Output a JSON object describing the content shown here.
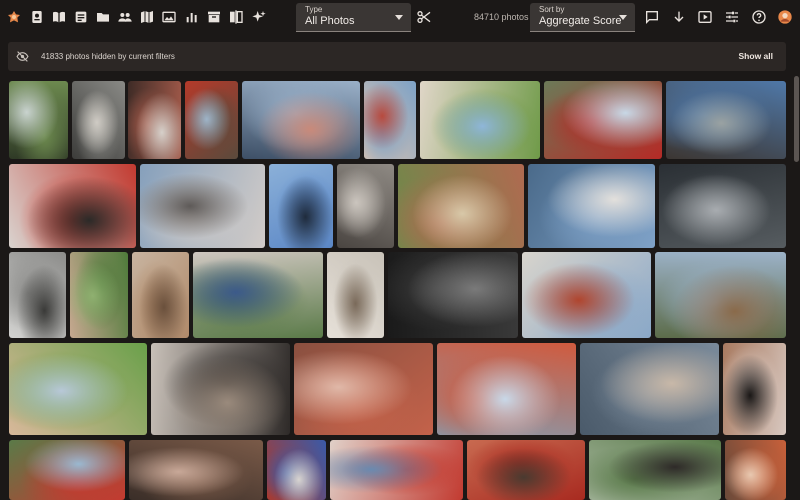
{
  "toolbar": {
    "left_icons": [
      "logo-icon",
      "person-badge-icon",
      "book-open-icon",
      "notes-icon",
      "folder-icon",
      "people-icon",
      "map-icon",
      "photo-library-icon",
      "bar-chart-icon",
      "archive-box-icon",
      "compare-icon",
      "sparkle-icon"
    ],
    "type_dropdown": {
      "label": "Type",
      "value": "All Photos"
    },
    "scissors_icon": "scissors-icon",
    "photo_count": "84710 photos",
    "sort_dropdown": {
      "label": "Sort by",
      "value": "Aggregate Score"
    },
    "right_icons": [
      "comment-icon",
      "sort-direction-icon",
      "slideshow-icon",
      "tune-icon",
      "help-icon",
      "avatar-icon"
    ]
  },
  "banner": {
    "icon": "eye-off-icon",
    "text": "41833 photos hidden by current filters",
    "action_label": "Show all"
  },
  "colors": {
    "background": "#1b1817",
    "banner": "#2c2725",
    "accent": "#e8884a"
  },
  "photos": [
    {
      "name": "photo-garden-path",
      "c": [
        "#6d8a4f",
        "#c9d3cf",
        "#2f3a26"
      ]
    },
    {
      "name": "photo-street-walkers",
      "c": [
        "#8a8a86",
        "#cfcbc4",
        "#3c3c3a"
      ]
    },
    {
      "name": "photo-child-red-clothes",
      "c": [
        "#a35a4a",
        "#d6d0ca",
        "#3e2b26"
      ]
    },
    {
      "name": "photo-child-tree-bench",
      "c": [
        "#5a4a3c",
        "#9eb4c8",
        "#b43a2a"
      ]
    },
    {
      "name": "photo-kids-hugging",
      "c": [
        "#9ab0c8",
        "#c98a7a",
        "#3d4f66"
      ]
    },
    {
      "name": "photo-woman-red-shirt",
      "c": [
        "#7ea2c6",
        "#b84a3e",
        "#d9c2b0"
      ]
    },
    {
      "name": "photo-child-pool",
      "c": [
        "#6f9a48",
        "#8fb6d9",
        "#e0d6c8"
      ]
    },
    {
      "name": "photo-red-flowers",
      "c": [
        "#b52a26",
        "#c8d8e6",
        "#6c7a58"
      ]
    },
    {
      "name": "photo-blue-doorway",
      "c": [
        "#4f78a8",
        "#9aa2a2",
        "#3c3632"
      ]
    },
    {
      "name": "photo-red-mask",
      "c": [
        "#c23a30",
        "#2b2a28",
        "#d9d3cf"
      ]
    },
    {
      "name": "photo-woman-headscarf",
      "c": [
        "#d2ccc8",
        "#5e5a58",
        "#86a0bc"
      ]
    },
    {
      "name": "photo-bicycle-sky",
      "c": [
        "#5b87c6",
        "#1f2b3c",
        "#8bb0d8"
      ]
    },
    {
      "name": "photo-child-window",
      "c": [
        "#8f8a84",
        "#cbc5be",
        "#4a4541"
      ]
    },
    {
      "name": "photo-girl-field",
      "c": [
        "#b06a50",
        "#d8c8a8",
        "#6c8a4a"
      ]
    },
    {
      "name": "photo-old-man-blue",
      "c": [
        "#7fa2c8",
        "#e3e0dc",
        "#4a6a8a"
      ]
    },
    {
      "name": "photo-misty-water",
      "c": [
        "#565c60",
        "#a8acb0",
        "#2a2f34"
      ]
    },
    {
      "name": "photo-street-scene",
      "c": [
        "#8c8c8a",
        "#3a3a38",
        "#d2d2d0"
      ]
    },
    {
      "name": "photo-tree-child",
      "c": [
        "#4e7a3a",
        "#8fb070",
        "#c6a890"
      ]
    },
    {
      "name": "photo-family-group",
      "c": [
        "#b08a6a",
        "#6a503c",
        "#c8b4a0"
      ]
    },
    {
      "name": "photo-family-outdoors",
      "c": [
        "#5a7a48",
        "#3c5a8a",
        "#cfc7c0"
      ]
    },
    {
      "name": "photo-child-white-hat",
      "c": [
        "#c8c2b8",
        "#7a6a5a",
        "#e6e0d8"
      ]
    },
    {
      "name": "photo-crowd-bw",
      "c": [
        "#3a3a3a",
        "#7a7a7a",
        "#1a1a1a"
      ]
    },
    {
      "name": "photo-umbrella-beach",
      "c": [
        "#8aa8c8",
        "#b0452e",
        "#d8d4cc"
      ]
    },
    {
      "name": "photo-people-hill",
      "c": [
        "#9cb2c8",
        "#8a6a4a",
        "#5c6c4a"
      ]
    },
    {
      "name": "photo-boy-green",
      "c": [
        "#6aa04a",
        "#b8c8d8",
        "#d8b89a"
      ]
    },
    {
      "name": "photo-child-bw-hands",
      "c": [
        "#2e2a28",
        "#9a8a7c",
        "#c8c0b8"
      ]
    },
    {
      "name": "photo-face-painting",
      "c": [
        "#c4624a",
        "#e0b8a8",
        "#8a5040"
      ]
    },
    {
      "name": "photo-child-cap-red",
      "c": [
        "#d05a3e",
        "#c8d8e8",
        "#8a98a8"
      ]
    },
    {
      "name": "photo-city-square",
      "c": [
        "#7a8a9a",
        "#c8b8a8",
        "#4a5a6a"
      ]
    },
    {
      "name": "photo-girl-black-top",
      "c": [
        "#d8c8c0",
        "#1a1716",
        "#a87a60"
      ]
    },
    {
      "name": "photo-red-car",
      "c": [
        "#c43a30",
        "#9ab8d0",
        "#5a7a48"
      ]
    },
    {
      "name": "photo-group-sitting",
      "c": [
        "#7a5a48",
        "#c8a898",
        "#3a2e28"
      ]
    },
    {
      "name": "photo-blue-character",
      "c": [
        "#3a5aa8",
        "#d8d4d0",
        "#a83a30"
      ]
    },
    {
      "name": "photo-red-crowd",
      "c": [
        "#c23a30",
        "#6a8ab0",
        "#e0d0c8"
      ]
    },
    {
      "name": "photo-festival-red",
      "c": [
        "#a82a20",
        "#4a3a30",
        "#c86a50"
      ]
    },
    {
      "name": "photo-trees-dusk",
      "c": [
        "#5a7a4a",
        "#2e2a28",
        "#a8b8a0"
      ]
    },
    {
      "name": "photo-girl-orange",
      "c": [
        "#c8603a",
        "#e8c8b0",
        "#6a4a3a"
      ]
    }
  ]
}
